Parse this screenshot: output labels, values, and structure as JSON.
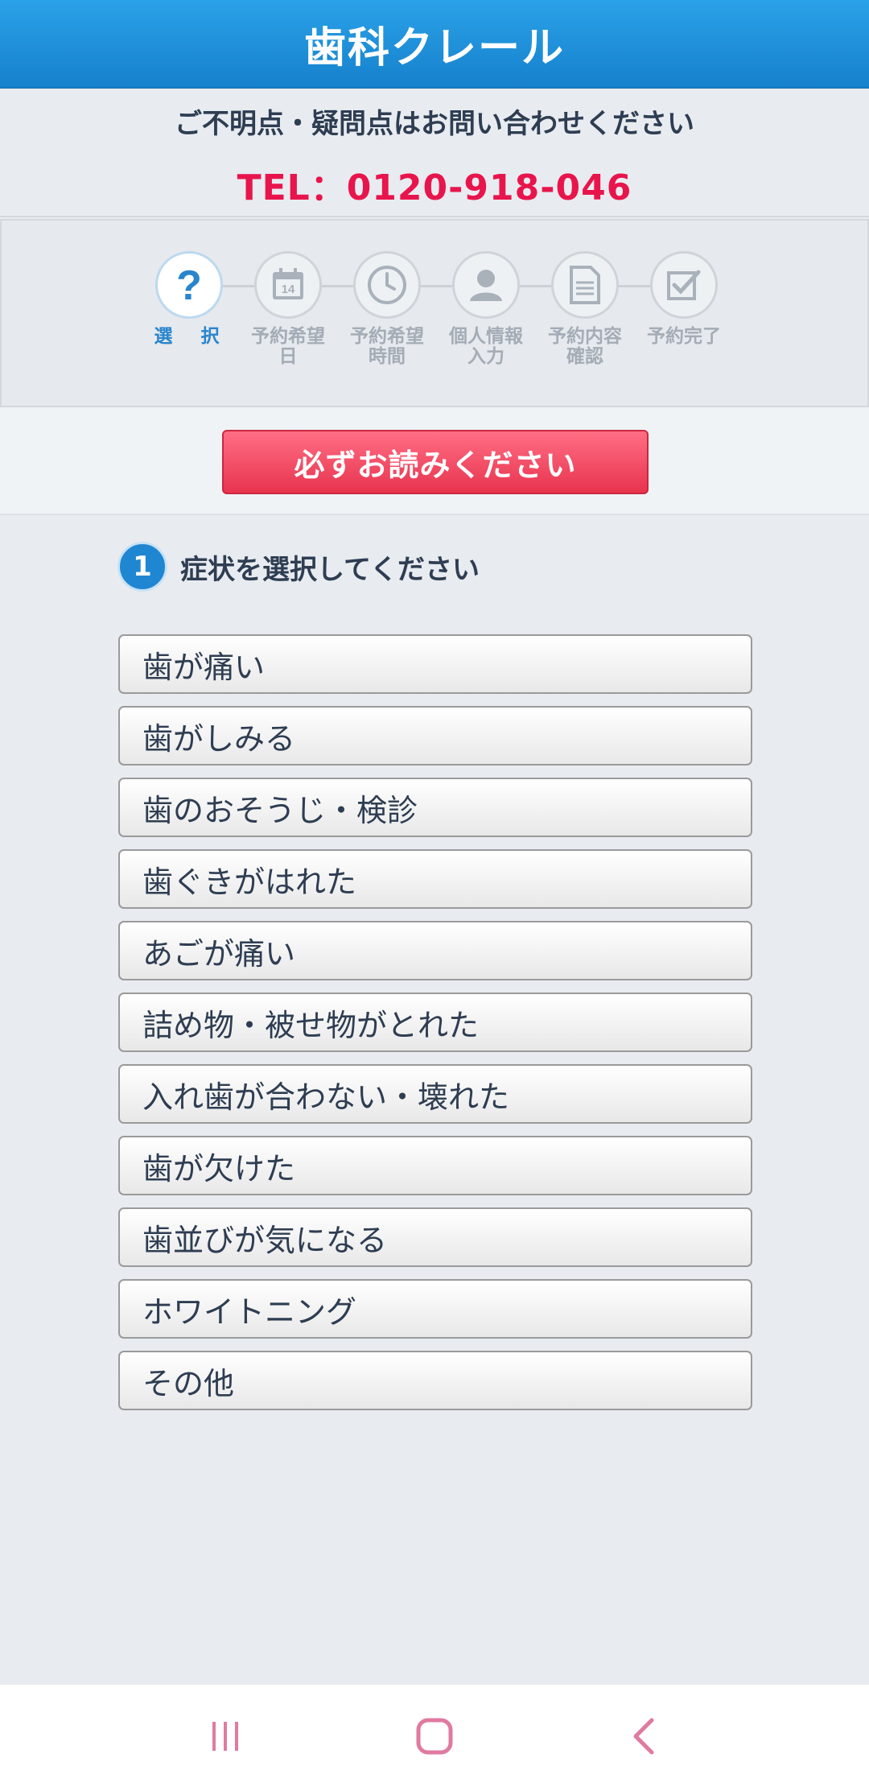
{
  "header": {
    "title": "歯科クレール"
  },
  "contact": {
    "note": "ご不明点・疑問点はお問い合わせください",
    "tel": "TEL：0120-918-046"
  },
  "steps": [
    {
      "label": "選　択",
      "icon": "question-icon",
      "active": true
    },
    {
      "label": "予約希望\n日",
      "icon": "calendar-icon",
      "calendar_day": "14",
      "active": false
    },
    {
      "label": "予約希望\n時間",
      "icon": "clock-icon",
      "active": false
    },
    {
      "label": "個人情報\n入力",
      "icon": "person-icon",
      "active": false
    },
    {
      "label": "予約内容\n確認",
      "icon": "document-icon",
      "active": false
    },
    {
      "label": "予約完了",
      "icon": "checkbox-icon",
      "active": false
    }
  ],
  "notice": {
    "label": "必ずお読みください"
  },
  "section": {
    "number": "1",
    "title": "症状を選択してください"
  },
  "options": [
    "歯が痛い",
    "歯がしみる",
    "歯のおそうじ・検診",
    "歯ぐきがはれた",
    "あごが痛い",
    "詰め物・被せ物がとれた",
    "入れ歯が合わない・壊れた",
    "歯が欠けた",
    "歯並びが気になる",
    "ホワイトニング",
    "その他"
  ],
  "navbar": {
    "recent": "recent-apps-icon",
    "home": "home-icon",
    "back": "back-icon"
  },
  "colors": {
    "primary": "#1f86d2",
    "accent": "#e8154d",
    "notice": "#f04a63"
  }
}
